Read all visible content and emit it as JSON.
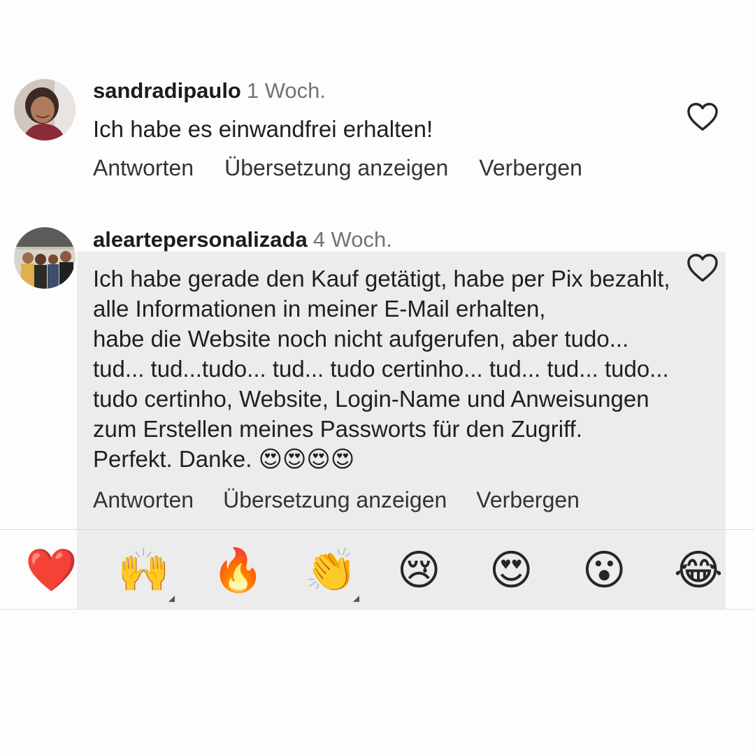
{
  "comments": [
    {
      "username": "sandradipaulo",
      "time": "1 Woch.",
      "text": "Ich habe es einwandfrei erhalten!",
      "actions": {
        "reply": "Antworten",
        "translate": "Übersetzung anzeigen",
        "hide": "Verbergen"
      }
    },
    {
      "username": "aleartepersonalizada",
      "time": "4 Woch.",
      "text": "Ich habe gerade den Kauf getätigt, habe per Pix bezahlt,\nalle Informationen in meiner E-Mail erhalten,\nhabe die Website noch nicht aufgerufen, aber tudo...\ntud... tud...tudo... tud... tudo certinho... tud... tud... tudo...\ntudo certinho, Website, Login-Name und Anweisungen\nzum Erstellen meines Passworts für den Zugriff.\nPerfekt. Danke. 😍😍😍😍",
      "actions": {
        "reply": "Antworten",
        "translate": "Übersetzung anzeigen",
        "hide": "Verbergen"
      }
    }
  ],
  "reactions": [
    {
      "name": "red-heart",
      "glyph": "❤️"
    },
    {
      "name": "raising-hands",
      "glyph": "🙌"
    },
    {
      "name": "fire",
      "glyph": "🔥"
    },
    {
      "name": "clapping-hands",
      "glyph": "👏"
    },
    {
      "name": "crying-face",
      "glyph": "😢"
    },
    {
      "name": "heart-eyes",
      "glyph": "😍"
    },
    {
      "name": "surprised-face",
      "glyph": "😮"
    },
    {
      "name": "tears-of-joy",
      "glyph": "😂"
    }
  ],
  "icons": {
    "like": "heart-outline-icon"
  },
  "colors": {
    "username": "#1c1c1c",
    "time": "#737373",
    "highlight": "#ececec",
    "heart_outline": "#262626"
  }
}
